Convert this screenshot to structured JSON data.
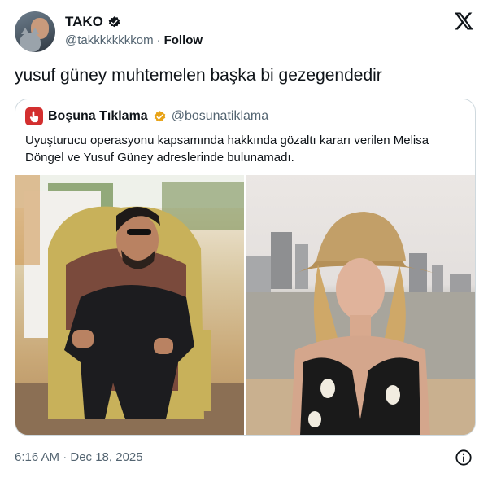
{
  "author": {
    "name": "TAKO",
    "handle": "@takkkkkkkkom",
    "separator": "·",
    "follow_label": "Follow"
  },
  "tweet": {
    "text": "yusuf güney muhtemelen başka bi gezegendedir"
  },
  "quoted": {
    "name": "Boşuna Tıklama",
    "handle": "@bosunatiklama",
    "text": "Uyuşturucu operasyonu kapsamında hakkında gözaltı kararı verilen Melisa Döngel ve Yusuf Güney adreslerinde bulunamadı."
  },
  "timestamp": "6:16 AM · Dec 18, 2025",
  "colors": {
    "verified": "#e8a317",
    "quote_logo": "#d32f2f",
    "secondary_text": "#536471"
  },
  "icons": [
    "verified-badge-icon",
    "x-logo-icon",
    "info-icon"
  ]
}
